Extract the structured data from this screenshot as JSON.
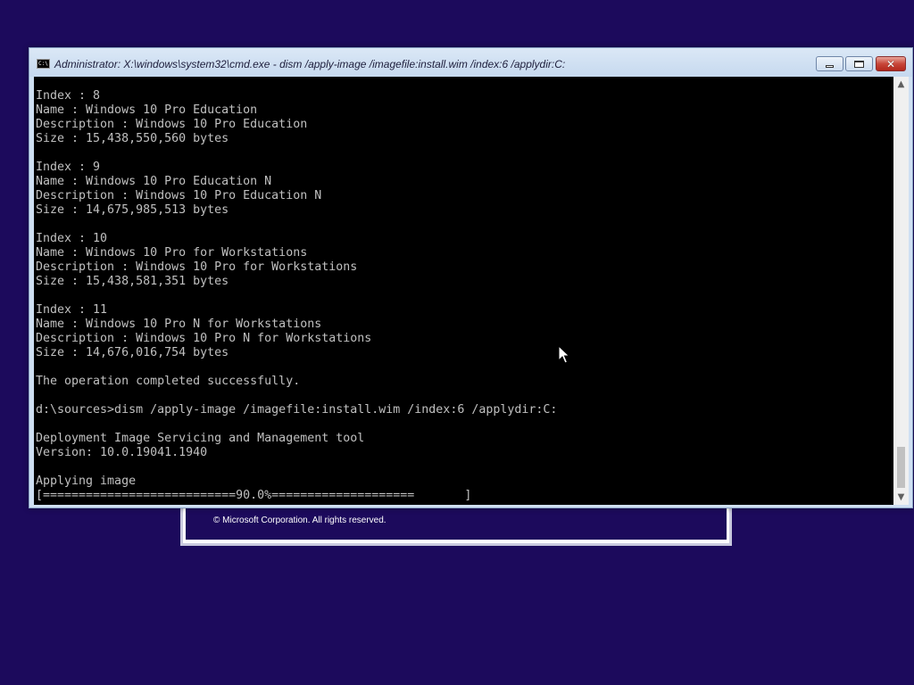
{
  "setup": {
    "copyright": "© Microsoft Corporation. All rights reserved."
  },
  "window": {
    "title": "Administrator: X:\\windows\\system32\\cmd.exe - dism  /apply-image /imagefile:install.wim /index:6 /applydir:C:",
    "icon_label": "C:\\",
    "close_glyph": "✕",
    "scroll_up_glyph": "▲",
    "scroll_down_glyph": "▼"
  },
  "console": {
    "lines": [
      "Index : 8",
      "Name : Windows 10 Pro Education",
      "Description : Windows 10 Pro Education",
      "Size : 15,438,550,560 bytes",
      "",
      "Index : 9",
      "Name : Windows 10 Pro Education N",
      "Description : Windows 10 Pro Education N",
      "Size : 14,675,985,513 bytes",
      "",
      "Index : 10",
      "Name : Windows 10 Pro for Workstations",
      "Description : Windows 10 Pro for Workstations",
      "Size : 15,438,581,351 bytes",
      "",
      "Index : 11",
      "Name : Windows 10 Pro N for Workstations",
      "Description : Windows 10 Pro N for Workstations",
      "Size : 14,676,016,754 bytes",
      "",
      "The operation completed successfully.",
      "",
      "d:\\sources>dism /apply-image /imagefile:install.wim /index:6 /applydir:C:",
      "",
      "Deployment Image Servicing and Management tool",
      "Version: 10.0.19041.1940",
      "",
      "Applying image",
      "[===========================90.0%====================       ]"
    ]
  },
  "progress_percent": 90.0,
  "colors": {
    "desktop": "#1c0a5c",
    "console_bg": "#000000",
    "console_fg": "#c0c0c0",
    "titlebar": "#cfe0f3",
    "close_button": "#c8473a"
  },
  "icons": [
    "cmd-icon",
    "minimize-icon",
    "maximize-icon",
    "close-icon",
    "scroll-up-icon",
    "scroll-down-icon",
    "mouse-cursor-icon"
  ]
}
